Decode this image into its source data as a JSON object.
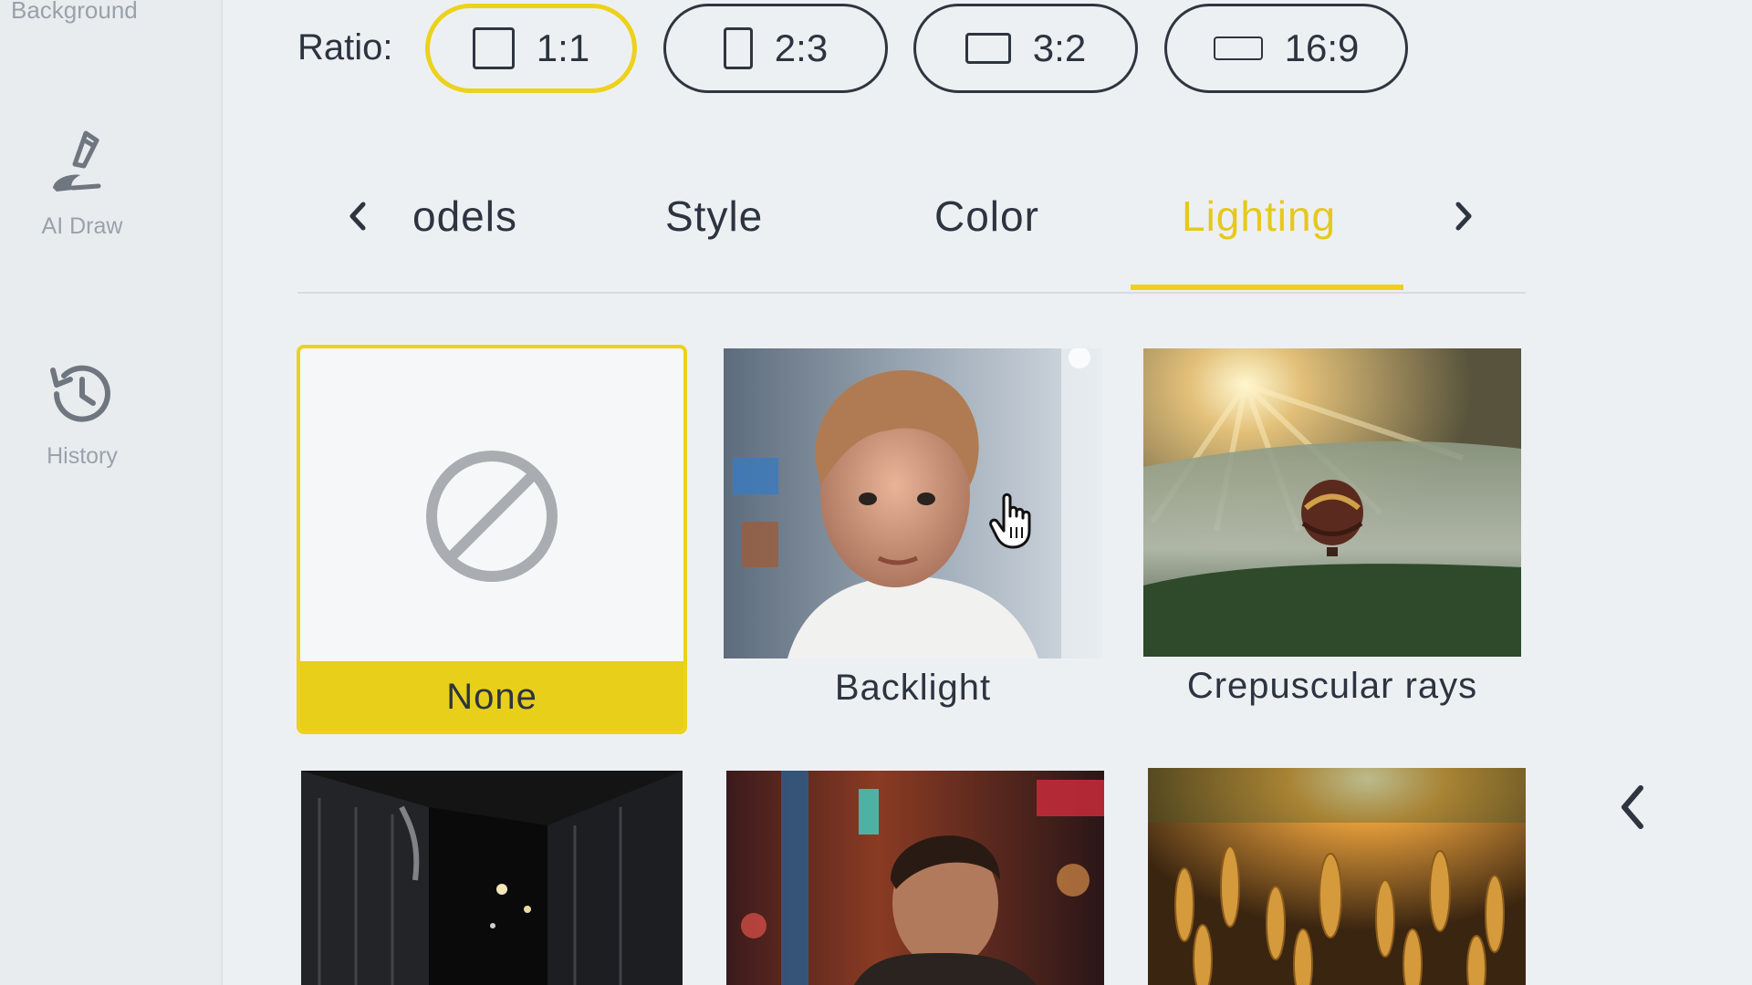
{
  "sidebar": {
    "top_label": "Background",
    "items": [
      {
        "label": "AI Draw",
        "icon": "pen-draw-icon"
      },
      {
        "label": "History",
        "icon": "history-clock-icon"
      }
    ]
  },
  "ratio": {
    "label": "Ratio:",
    "options": [
      {
        "label": "1:1",
        "shape": "square",
        "active": true
      },
      {
        "label": "2:3",
        "shape": "portrait"
      },
      {
        "label": "3:2",
        "shape": "landscape"
      },
      {
        "label": "16:9",
        "shape": "widescreen"
      }
    ]
  },
  "tabs": {
    "items": [
      "odels",
      "Style",
      "Color",
      "Lighting"
    ],
    "active": "Lighting"
  },
  "lighting_options": [
    {
      "label": "None",
      "selected": true
    },
    {
      "label": "Backlight"
    },
    {
      "label": "Crepuscular rays"
    },
    {
      "label": ""
    },
    {
      "label": ""
    },
    {
      "label": ""
    }
  ],
  "colors": {
    "accent": "#ecd21c",
    "accent_text": "#e6c81d",
    "text": "#2d3440",
    "muted": "#9aa1aa"
  }
}
